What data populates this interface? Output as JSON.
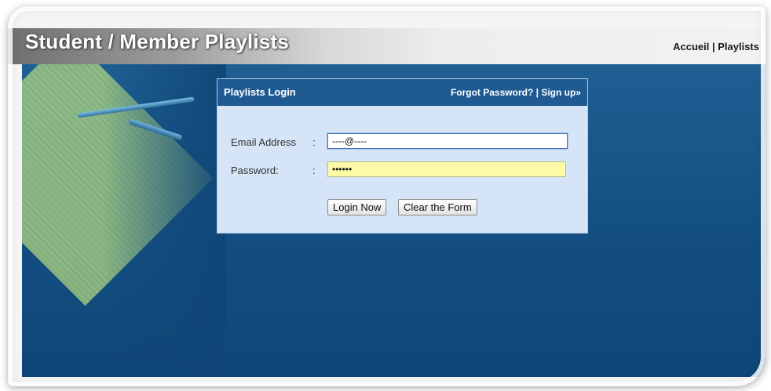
{
  "header": {
    "title": "Student / Member Playlists",
    "nav": [
      "Accueil",
      "Playlists"
    ],
    "nav_separator": "|"
  },
  "login": {
    "title": "Playlists Login",
    "forgot_password": "Forgot Password?",
    "link_separator": "|",
    "sign_up": "Sign up»",
    "email_label": "Email Address",
    "email_value": "----@----",
    "password_label": "Password:",
    "password_value": "••••••",
    "label_colon": ":",
    "login_button": "Login Now",
    "clear_button": "Clear the Form"
  },
  "colors": {
    "page_background": "#134d80",
    "panel_header": "#1f5a92",
    "panel_body": "#d5e4f6",
    "password_highlight": "#fbfaa7"
  }
}
